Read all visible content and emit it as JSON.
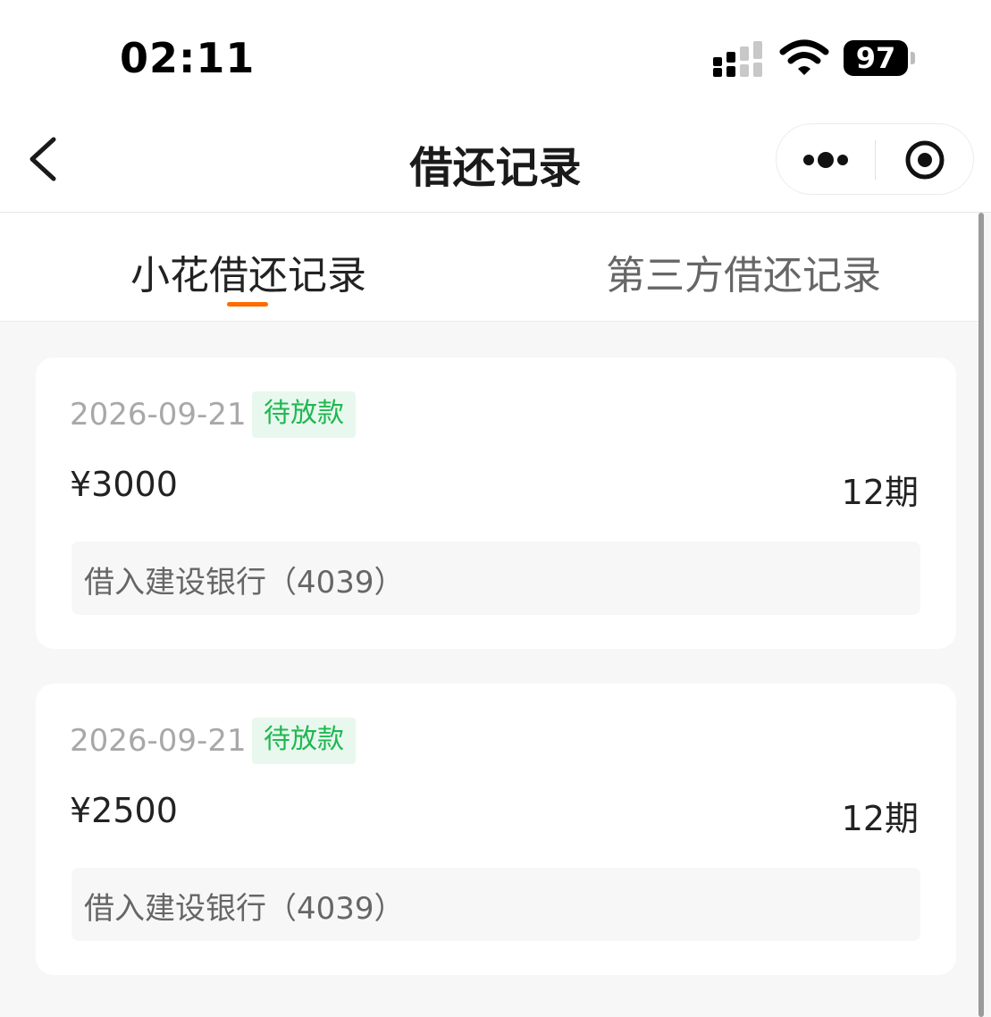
{
  "status_bar": {
    "time": "02:11",
    "battery": "97",
    "icons": [
      "signal-icon",
      "wifi-icon",
      "battery-icon"
    ]
  },
  "nav": {
    "title": "借还记录",
    "icons": [
      "back-chevron-icon",
      "more-dots-icon",
      "close-target-icon"
    ]
  },
  "tabs": [
    {
      "label": "小花借还记录",
      "active": true
    },
    {
      "label": "第三方借还记录",
      "active": false
    }
  ],
  "colors": {
    "accent": "#ff6a00",
    "status_green": "#1fb852",
    "status_green_bg": "#e9f8ee"
  },
  "records": [
    {
      "date": "2026-09-21",
      "status": "待放款",
      "amount": "¥3000",
      "term": "12期",
      "bank": "借入建设银行（4039）"
    },
    {
      "date": "2026-09-21",
      "status": "待放款",
      "amount": "¥2500",
      "term": "12期",
      "bank": "借入建设银行（4039）"
    }
  ]
}
